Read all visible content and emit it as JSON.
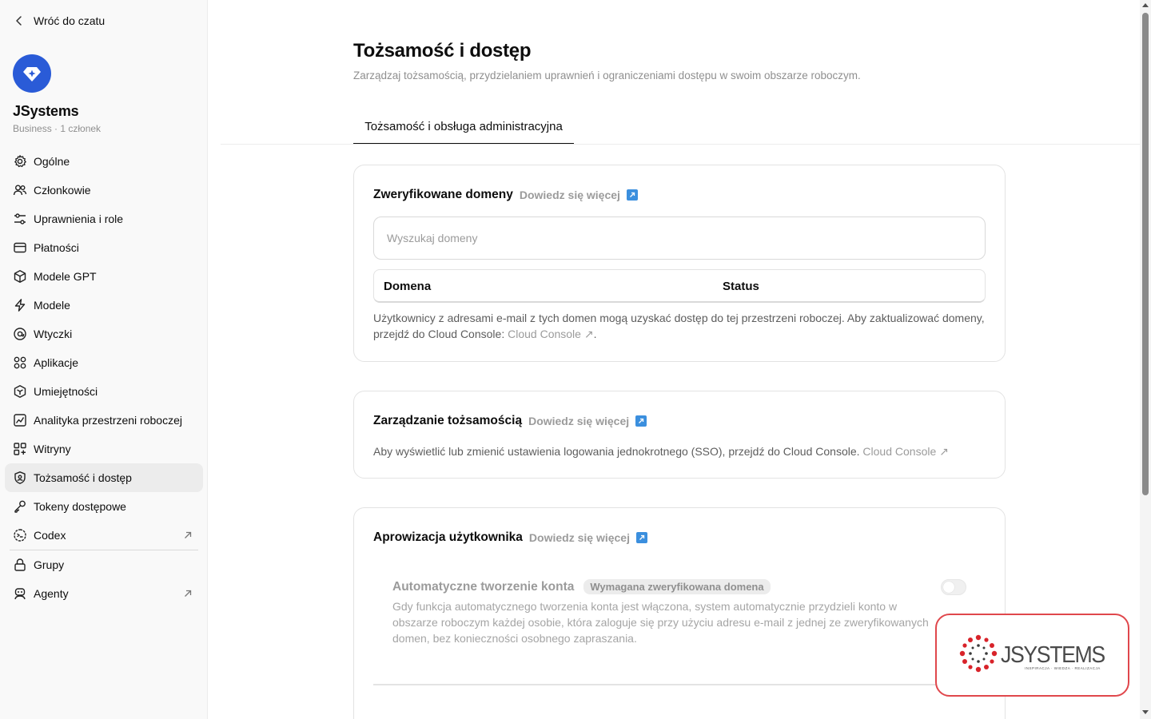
{
  "sidebar": {
    "back_label": "Wróć do czatu",
    "workspace_name": "JSystems",
    "workspace_sub": "Business · 1 członek",
    "items": [
      {
        "label": "Ogólne",
        "icon": "gear-icon"
      },
      {
        "label": "Członkowie",
        "icon": "members-icon"
      },
      {
        "label": "Uprawnienia i role",
        "icon": "sliders-icon"
      },
      {
        "label": "Płatności",
        "icon": "card-icon"
      },
      {
        "label": "Modele GPT",
        "icon": "cube-icon"
      },
      {
        "label": "Modele",
        "icon": "bolt-icon"
      },
      {
        "label": "Wtyczki",
        "icon": "plugin-icon"
      },
      {
        "label": "Aplikacje",
        "icon": "apps-icon"
      },
      {
        "label": "Umiejętności",
        "icon": "skills-icon"
      },
      {
        "label": "Analityka przestrzeni roboczej",
        "icon": "chart-icon"
      },
      {
        "label": "Witryny",
        "icon": "sites-icon"
      },
      {
        "label": "Tożsamość i dostęp",
        "icon": "shield-icon",
        "active": true
      },
      {
        "label": "Tokeny dostępowe",
        "icon": "key-icon"
      },
      {
        "label": "Codex",
        "icon": "codex-icon",
        "external": true
      }
    ],
    "items_after": [
      {
        "label": "Grupy",
        "icon": "lock-icon"
      },
      {
        "label": "Agenty",
        "icon": "agent-icon",
        "external": true
      }
    ]
  },
  "main": {
    "title": "Tożsamość i dostęp",
    "subtitle": "Zarządzaj tożsamością, przydzielaniem uprawnień i ograniczeniami dostępu w swoim obszarze roboczym.",
    "tab": "Tożsamość i obsługa administracyjna",
    "domains": {
      "title": "Zweryfikowane domeny",
      "learn_more": "Dowiedz się więcej",
      "search_placeholder": "Wyszukaj domeny",
      "col_domain": "Domena",
      "col_status": "Status",
      "text": "Użytkownicy z adresami e-mail z tych domen mogą uzyskać dostęp do tej przestrzeni roboczej. Aby zaktualizować domeny, przejdź do Cloud Console: ",
      "link": "Cloud Console ↗",
      "after_link": "."
    },
    "identity": {
      "title": "Zarządzanie tożsamością",
      "learn_more": "Dowiedz się więcej",
      "text": "Aby wyświetlić lub zmienić ustawienia logowania jednokrotnego (SSO), przejdź do Cloud Console. ",
      "link": "Cloud Console ↗"
    },
    "provisioning": {
      "title": "Aprowizacja użytkownika",
      "learn_more": "Dowiedz się więcej",
      "auto_title": "Automatyczne tworzenie konta",
      "auto_badge": "Wymagana zweryfikowana domena",
      "auto_desc": "Gdy funkcja automatycznego tworzenia konta jest włączona, system automatycznie przydzieli konto w obszarze roboczym każdej osobie, która zaloguje się przy użyciu adresu e-mail z jednej ze zweryfikowanych domen, bez konieczności osobnego zapraszania.",
      "auto_enabled": false
    }
  },
  "watermark": {
    "brand": "JSYSTEMS",
    "tagline": "INSPIRACJA · WIEDZA · REALIZACJA"
  },
  "colors": {
    "accent_logo": "#2a5bd7",
    "external_badge": "#3b8fde",
    "watermark_border": "#e0474c"
  }
}
